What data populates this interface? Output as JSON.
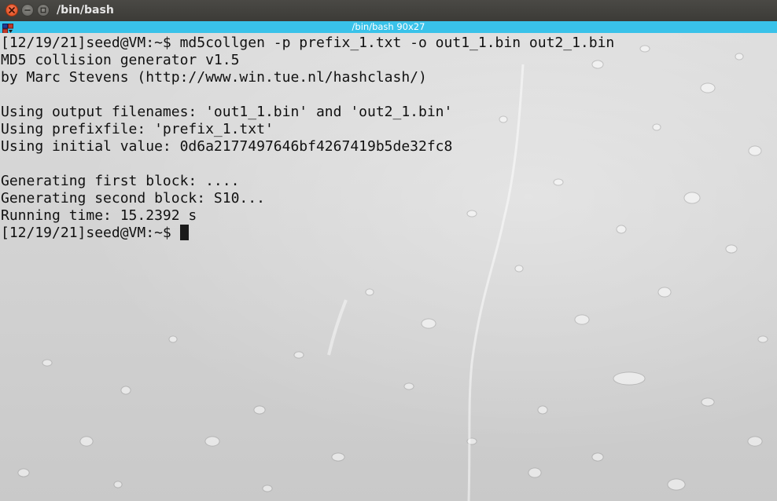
{
  "window": {
    "title": "/bin/bash",
    "close_icon": "close-icon",
    "minimize_icon": "minimize-icon",
    "maximize_icon": "maximize-icon"
  },
  "tab": {
    "title": "/bin/bash 90x27",
    "menu_icon": "terminal-menu-icon",
    "accent_color": "#39c2e9"
  },
  "terminal": {
    "lines": [
      "[12/19/21]seed@VM:~$ md5collgen -p prefix_1.txt -o out1_1.bin out2_1.bin",
      "MD5 collision generator v1.5",
      "by Marc Stevens (http://www.win.tue.nl/hashclash/)",
      "",
      "Using output filenames: 'out1_1.bin' and 'out2_1.bin'",
      "Using prefixfile: 'prefix_1.txt'",
      "Using initial value: 0d6a2177497646bf4267419b5de32fc8",
      "",
      "Generating first block: ....",
      "Generating second block: S10...",
      "Running time: 15.2392 s"
    ],
    "prompt": "[12/19/21]seed@VM:~$ ",
    "text_color": "#111111",
    "background": "raindrops-wallpaper"
  }
}
